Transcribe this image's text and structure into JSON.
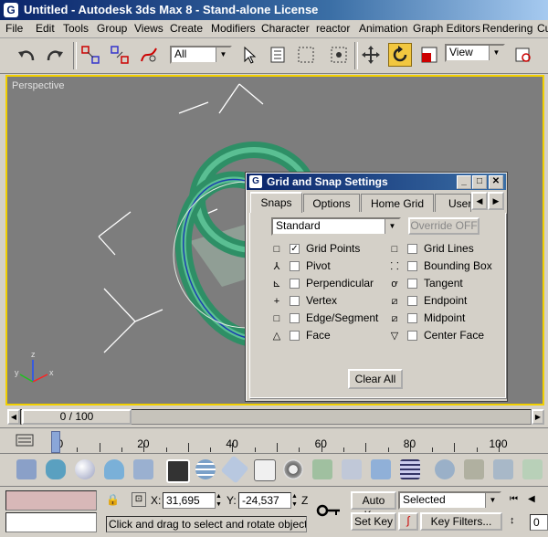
{
  "window": {
    "title": "Untitled - Autodesk 3ds Max 8  - Stand-alone License",
    "app_icon": "G"
  },
  "menu": [
    "File",
    "Edit",
    "Tools",
    "Group",
    "Views",
    "Create",
    "Modifiers",
    "Character",
    "reactor",
    "Animation",
    "Graph Editors",
    "Rendering",
    "Cu"
  ],
  "toolbar": {
    "selection_filter": "All",
    "ref_coord": "View",
    "icons": [
      "undo-icon",
      "redo-icon",
      "select-link-icon",
      "unlink-icon",
      "bind-space-warp-icon",
      "select-icon",
      "select-by-name-icon",
      "rect-region-icon",
      "window-crossing-icon",
      "select-move-icon",
      "select-rotate-icon",
      "select-scale-icon",
      "use-center-icon"
    ]
  },
  "viewport": {
    "label": "Perspective",
    "axes": {
      "x": "x",
      "y": "y",
      "z": "z"
    }
  },
  "dialog": {
    "title": "Grid and Snap Settings",
    "app_icon": "G",
    "tabs": [
      "Snaps",
      "Options",
      "Home Grid",
      "User"
    ],
    "selected_tab": "Snaps",
    "preset": "Standard",
    "override_label": "Override OFF",
    "left_snaps": [
      {
        "label": "Grid Points",
        "checked": true,
        "icon": "grid-points-icon",
        "glyph": "□"
      },
      {
        "label": "Pivot",
        "checked": false,
        "icon": "pivot-icon",
        "glyph": "⅄"
      },
      {
        "label": "Perpendicular",
        "checked": false,
        "icon": "perpendicular-icon",
        "glyph": "⊾"
      },
      {
        "label": "Vertex",
        "checked": false,
        "icon": "vertex-icon",
        "glyph": "+"
      },
      {
        "label": "Edge/Segment",
        "checked": false,
        "icon": "edge-segment-icon",
        "glyph": "□"
      },
      {
        "label": "Face",
        "checked": false,
        "icon": "face-icon",
        "glyph": "△"
      }
    ],
    "right_snaps": [
      {
        "label": "Grid Lines",
        "checked": false,
        "icon": "grid-lines-icon",
        "glyph": "□"
      },
      {
        "label": "Bounding Box",
        "checked": false,
        "icon": "bounding-box-icon",
        "glyph": "⸬"
      },
      {
        "label": "Tangent",
        "checked": false,
        "icon": "tangent-icon",
        "glyph": "ơ"
      },
      {
        "label": "Endpoint",
        "checked": false,
        "icon": "endpoint-icon",
        "glyph": "⧄"
      },
      {
        "label": "Midpoint",
        "checked": false,
        "icon": "midpoint-icon",
        "glyph": "⧄"
      },
      {
        "label": "Center Face",
        "checked": false,
        "icon": "center-face-icon",
        "glyph": "▽"
      }
    ],
    "clear_all": "Clear All"
  },
  "timeline": {
    "frame_display": "0 / 100",
    "current_frame": 0,
    "max_frame": 100,
    "ruler_labels": [
      "0",
      "20",
      "40",
      "60",
      "80",
      "100"
    ]
  },
  "status": {
    "x_label": "X:",
    "x_value": "31,695",
    "y_label": "Y:",
    "y_value": "-24,537",
    "z_label": "Z",
    "auto_key": "Auto Key",
    "set_key": "Set Key",
    "selected": "Selected",
    "key_filters": "Key Filters...",
    "prompt": "Click and drag to select and rotate objects",
    "frame_field": "0"
  },
  "colors": {
    "torus": "#3da07a",
    "viewport_border": "#f2d000",
    "active_button": "#f2c740"
  }
}
